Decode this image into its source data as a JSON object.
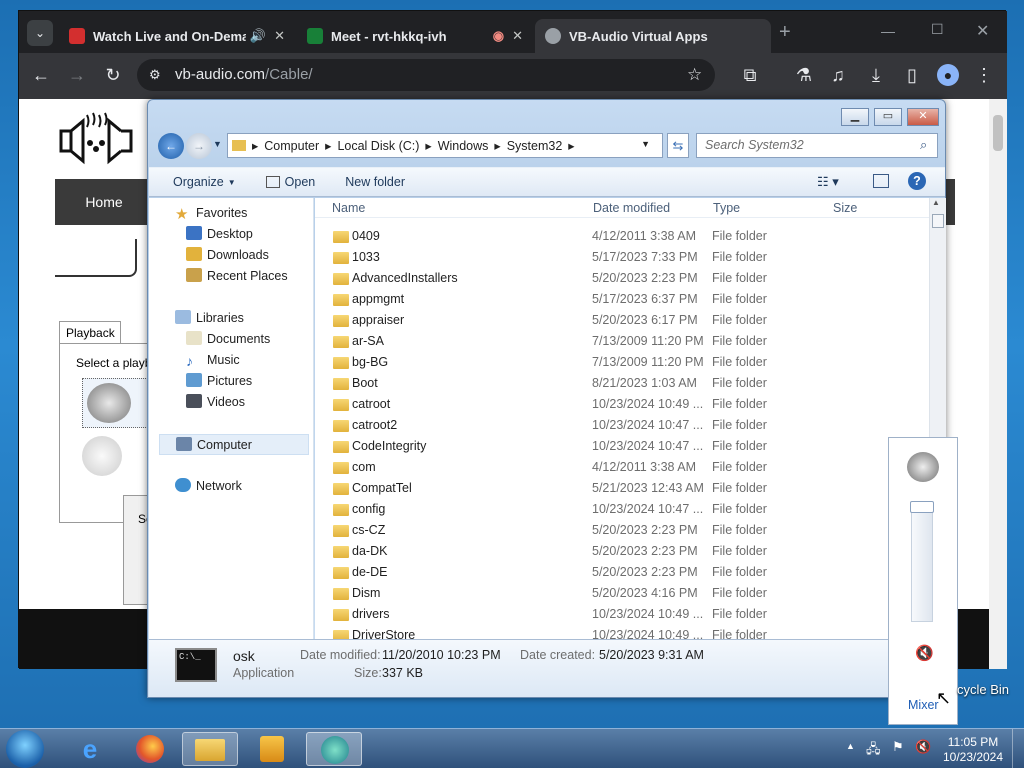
{
  "browser": {
    "tabs": [
      {
        "title": "Watch Live and On-Deman",
        "fav_color": "#d32f2f"
      },
      {
        "title": "Meet - rvt-hkkq-ivh",
        "fav_color": "#188038"
      },
      {
        "title": "VB-Audio Virtual Apps",
        "fav_color": "#9aa0a6"
      }
    ],
    "url_host": "vb-audio.com",
    "url_path": "/Cable/",
    "new_tab": "+"
  },
  "site": {
    "nav_home": "Home",
    "playback_tab": "Playback",
    "select_text": "Select a playba",
    "se_text": "Se"
  },
  "explorer": {
    "breadcrumb": [
      "Computer",
      "Local Disk (C:)",
      "Windows",
      "System32"
    ],
    "search_placeholder": "Search System32",
    "toolbar": {
      "organize": "Organize",
      "open": "Open",
      "new_folder": "New folder"
    },
    "nav": {
      "favorites": "Favorites",
      "favorites_items": [
        "Desktop",
        "Downloads",
        "Recent Places"
      ],
      "libraries": "Libraries",
      "libraries_items": [
        "Documents",
        "Music",
        "Pictures",
        "Videos"
      ],
      "computer": "Computer",
      "network": "Network"
    },
    "columns": {
      "name": "Name",
      "date": "Date modified",
      "type": "Type",
      "size": "Size"
    },
    "files": [
      {
        "name": "0409",
        "date": "4/12/2011 3:38 AM",
        "type": "File folder"
      },
      {
        "name": "1033",
        "date": "5/17/2023 7:33 PM",
        "type": "File folder"
      },
      {
        "name": "AdvancedInstallers",
        "date": "5/20/2023 2:23 PM",
        "type": "File folder"
      },
      {
        "name": "appmgmt",
        "date": "5/17/2023 6:37 PM",
        "type": "File folder"
      },
      {
        "name": "appraiser",
        "date": "5/20/2023 6:17 PM",
        "type": "File folder"
      },
      {
        "name": "ar-SA",
        "date": "7/13/2009 11:20 PM",
        "type": "File folder"
      },
      {
        "name": "bg-BG",
        "date": "7/13/2009 11:20 PM",
        "type": "File folder"
      },
      {
        "name": "Boot",
        "date": "8/21/2023 1:03 AM",
        "type": "File folder"
      },
      {
        "name": "catroot",
        "date": "10/23/2024 10:49 ...",
        "type": "File folder"
      },
      {
        "name": "catroot2",
        "date": "10/23/2024 10:47 ...",
        "type": "File folder"
      },
      {
        "name": "CodeIntegrity",
        "date": "10/23/2024 10:47 ...",
        "type": "File folder"
      },
      {
        "name": "com",
        "date": "4/12/2011 3:38 AM",
        "type": "File folder"
      },
      {
        "name": "CompatTel",
        "date": "5/21/2023 12:43 AM",
        "type": "File folder"
      },
      {
        "name": "config",
        "date": "10/23/2024 10:47 ...",
        "type": "File folder"
      },
      {
        "name": "cs-CZ",
        "date": "5/20/2023 2:23 PM",
        "type": "File folder"
      },
      {
        "name": "da-DK",
        "date": "5/20/2023 2:23 PM",
        "type": "File folder"
      },
      {
        "name": "de-DE",
        "date": "5/20/2023 2:23 PM",
        "type": "File folder"
      },
      {
        "name": "Dism",
        "date": "5/20/2023 4:16 PM",
        "type": "File folder"
      },
      {
        "name": "drivers",
        "date": "10/23/2024 10:49 ...",
        "type": "File folder"
      },
      {
        "name": "DriverStore",
        "date": "10/23/2024 10:49 ...",
        "type": "File folder"
      }
    ],
    "details": {
      "name": "osk",
      "kind": "Application",
      "modified_label": "Date modified:",
      "modified": "11/20/2010 10:23 PM",
      "created_label": "Date created:",
      "created": "5/20/2023 9:31 AM",
      "size_label": "Size:",
      "size": "337 KB"
    }
  },
  "volume": {
    "mixer": "Mixer"
  },
  "desktop": {
    "recycle_bin": "cycle Bin"
  },
  "taskbar": {
    "time": "11:05 PM",
    "date": "10/23/2024"
  }
}
